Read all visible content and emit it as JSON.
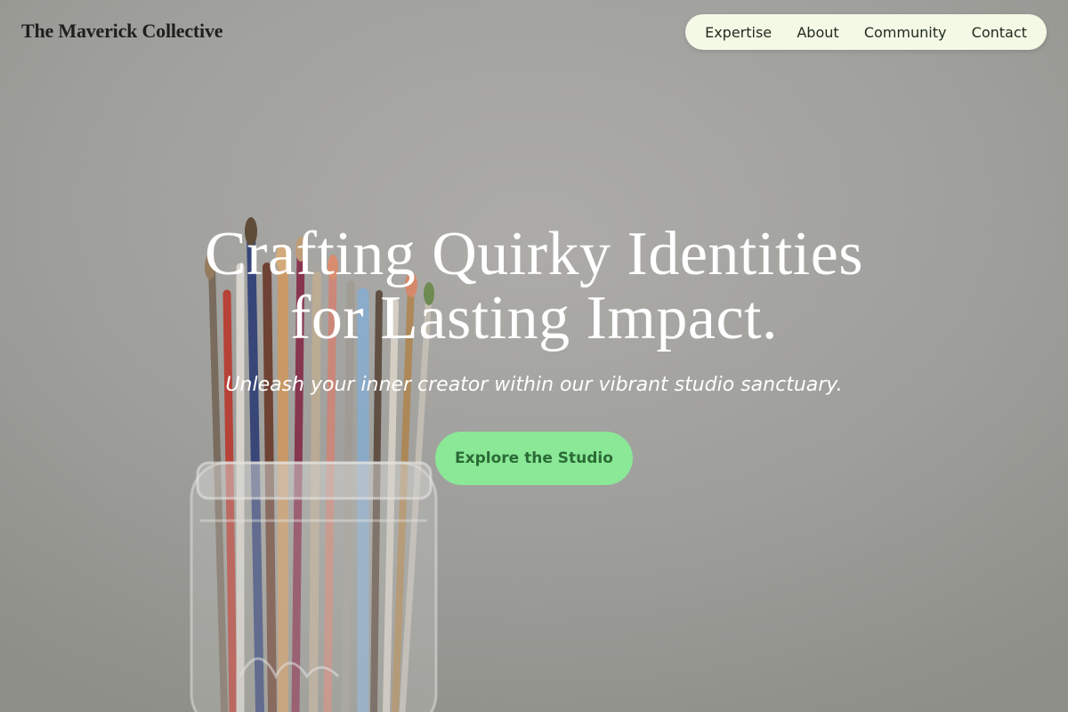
{
  "brand": {
    "name": "The Maverick Collective"
  },
  "nav": {
    "items": [
      {
        "label": "Expertise"
      },
      {
        "label": "About"
      },
      {
        "label": "Community"
      },
      {
        "label": "Contact"
      }
    ]
  },
  "hero": {
    "headline_line1": "Crafting Quirky Identities",
    "headline_line2": "for Lasting Impact.",
    "tagline": "Unleash your inner creator within our vibrant studio sanctuary.",
    "cta_label": "Explore the Studio"
  },
  "colors": {
    "nav_bg": "#f4f9e6",
    "cta_bg": "#8ae897",
    "cta_text": "#2a6b36",
    "headline": "#ffffff"
  }
}
